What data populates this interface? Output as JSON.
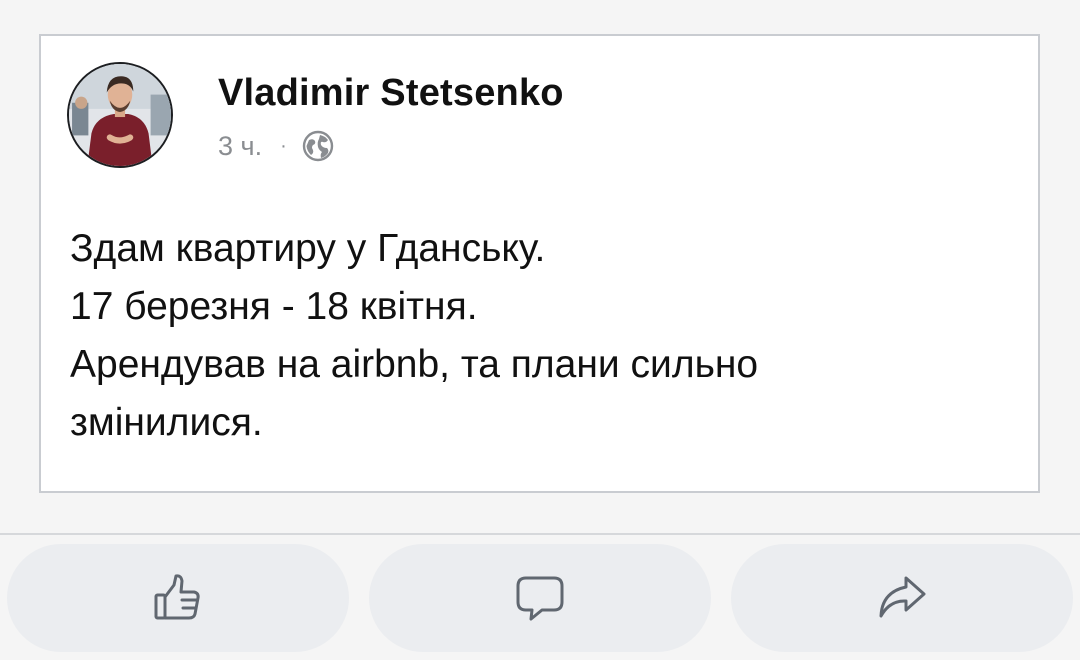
{
  "post": {
    "author": "Vladimir Stetsenko",
    "time": "3 ч.",
    "separator": "·",
    "privacy_icon": "globe-icon",
    "text_lines": [
      "Здам квартиру у Гданську.",
      "17 березня - 18 квітня.",
      "Арендував на airbnb, та плани сильно",
      "змінилися."
    ]
  },
  "actions": [
    {
      "icon": "like-icon"
    },
    {
      "icon": "comment-icon"
    },
    {
      "icon": "share-icon"
    }
  ],
  "colors": {
    "background": "#f5f5f5",
    "card": "#ffffff",
    "card_border": "#c9ccd1",
    "text": "#111111",
    "meta_text": "#8a8d91",
    "action_button": "#ebedf0",
    "icon_stroke": "#606770"
  }
}
